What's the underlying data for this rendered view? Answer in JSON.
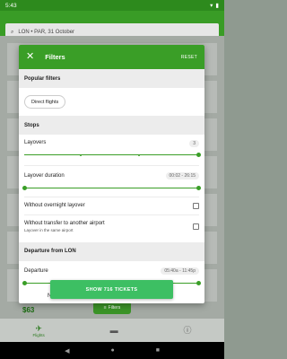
{
  "status": {
    "time": "5:43",
    "battery_icon": "battery-icon",
    "wifi_icon": "wifi-icon"
  },
  "search": {
    "text": "LON • PAR, 31 October"
  },
  "background": {
    "price": "$63",
    "filters_button": "Filters"
  },
  "bottom_nav": [
    {
      "label": "Flights",
      "icon": "plane-icon"
    },
    {
      "label": "",
      "icon": "hotel-icon"
    },
    {
      "label": "",
      "icon": "info-icon"
    }
  ],
  "dialog": {
    "title": "Filters",
    "reset_label": "RESET",
    "sections": {
      "popular": {
        "heading": "Popular filters",
        "chip": "Direct flights"
      },
      "stops": {
        "heading": "Stops",
        "layovers": {
          "label": "Layovers",
          "value": "3"
        },
        "layover_duration": {
          "label": "Layover duration",
          "value": "00:02 - 26:15"
        },
        "overnight": {
          "label": "Without overnight layover"
        },
        "transfer": {
          "label": "Without transfer to another airport",
          "sub": "Layover in the same airport"
        }
      },
      "departure": {
        "heading": "Departure from LON",
        "departure": {
          "label": "Departure",
          "value": "05:40a - 11:45p"
        },
        "partial_label": "N"
      }
    },
    "show_button": "SHOW 716 TICKETS"
  },
  "colors": {
    "primary_green": "#3a9e27",
    "button_green": "#3dbf63"
  }
}
